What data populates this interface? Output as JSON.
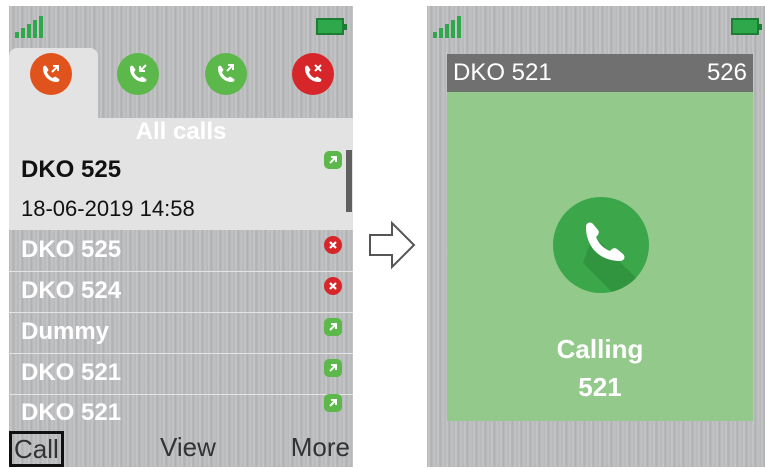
{
  "left_screen": {
    "tabs": [
      {
        "name": "all-calls",
        "color": "#e0531d"
      },
      {
        "name": "received-calls",
        "color": "#5cb84a"
      },
      {
        "name": "dialed-calls",
        "color": "#5cb84a"
      },
      {
        "name": "missed-calls",
        "color": "#d7262a"
      }
    ],
    "list_title": "All calls",
    "selected": {
      "name": "DKO 525",
      "datetime": "18-06-2019 14:58",
      "status_icon": "outgoing-arrow-icon"
    },
    "rows": [
      {
        "label": "DKO 525",
        "status_icon": "missed-x-icon"
      },
      {
        "label": "DKO 524",
        "status_icon": "missed-x-icon"
      },
      {
        "label": "Dummy",
        "status_icon": "outgoing-arrow-icon"
      },
      {
        "label": "DKO 521",
        "status_icon": "outgoing-arrow-icon"
      },
      {
        "label": "DKO 521",
        "status_icon": "outgoing-arrow-icon"
      }
    ],
    "softkeys": {
      "call": "Call",
      "view": "View",
      "more": "More"
    }
  },
  "right_screen": {
    "header_left": "DKO 521",
    "header_right": "526",
    "status": "Calling",
    "number": "521"
  },
  "colors": {
    "signal_green": "#2ea84a",
    "missed_red": "#d7262a",
    "outgoing_green": "#5cb84a",
    "calling_panel": "#94c98c"
  }
}
